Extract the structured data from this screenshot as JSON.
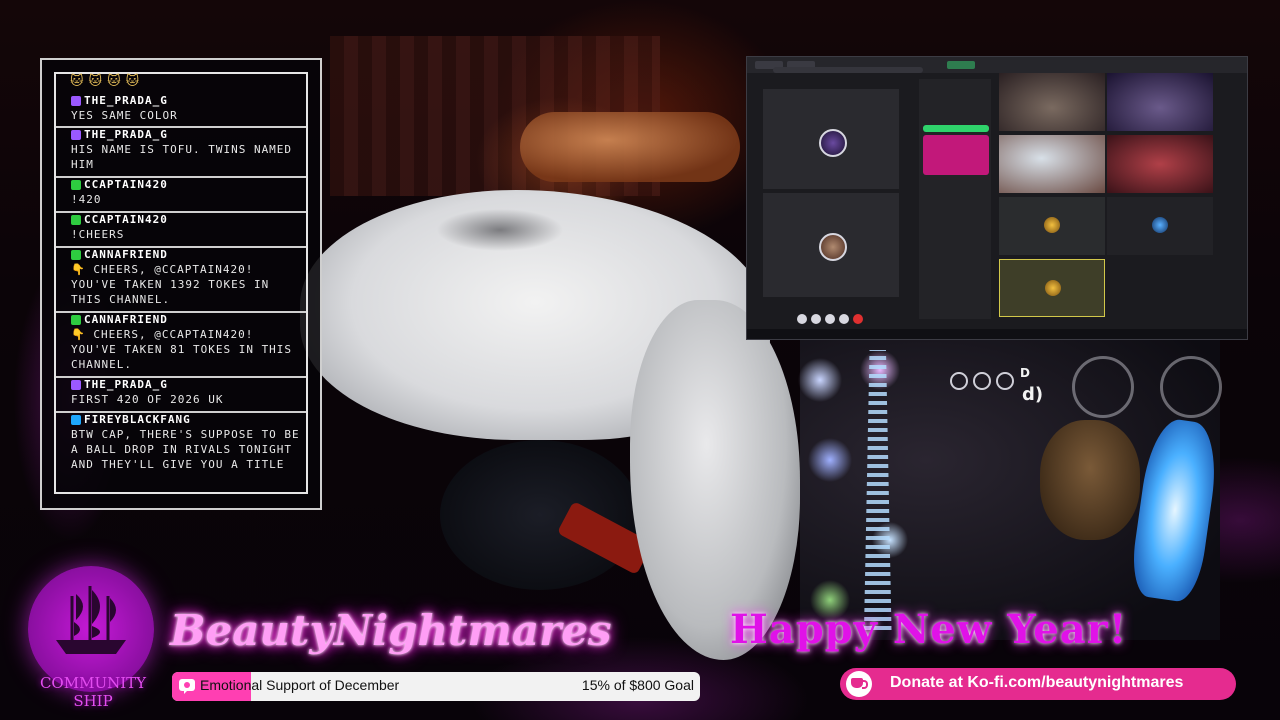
{
  "chat": {
    "header_badges": "🐱🐱🐱🐱",
    "messages": [
      {
        "user": "THE_PRADA_G",
        "text": "YES SAME COLOR",
        "badge_color": "#9b59ff"
      },
      {
        "user": "THE_PRADA_G",
        "text": "HIS NAME IS TOFU. TWINS NAMED HIM",
        "badge_color": "#9b59ff"
      },
      {
        "user": "CCAPTAIN420",
        "text": "!420",
        "badge_color": "#2ecc40"
      },
      {
        "user": "CCAPTAIN420",
        "text": "!CHEERS",
        "badge_color": "#2ecc40"
      },
      {
        "user": "CANNAFRIEND",
        "text": "👇 CHEERS, @CCAPTAIN420! YOU'VE TAKEN 1392 TOKES IN THIS CHANNEL.",
        "badge_color": "#2ecc40"
      },
      {
        "user": "CANNAFRIEND",
        "text": "👇 CHEERS, @CCAPTAIN420! YOU'VE TAKEN 81 TOKES IN THIS CHANNEL.",
        "badge_color": "#2ecc40"
      },
      {
        "user": "THE_PRADA_G",
        "text": "FIRST 420 OF 2026 UK",
        "badge_color": "#9b59ff"
      },
      {
        "user": "FIREYBLACKFANG",
        "text": "BTW CAP, THERE'S SUPPOSE TO BE A BALL DROP IN RIVALS TONIGHT AND THEY'LL GIVE YOU A TITLE",
        "badge_color": "#1ea8ff"
      }
    ]
  },
  "scene": {
    "fragment_top": "D",
    "fragment_bottom": "d)"
  },
  "branding": {
    "logo_text": "COMMUNITY SHIP",
    "channel_name": "BeautyNightmares",
    "greeting": "Happy New Year!"
  },
  "goal": {
    "title": "Emotional Support of December",
    "progress_text": "15% of $800 Goal",
    "percent": 15,
    "fill_color": "#ff3fb2"
  },
  "donate": {
    "label": "Donate at Ko-fi.com/beautynightmares",
    "icon": "kofi-cup-icon"
  }
}
